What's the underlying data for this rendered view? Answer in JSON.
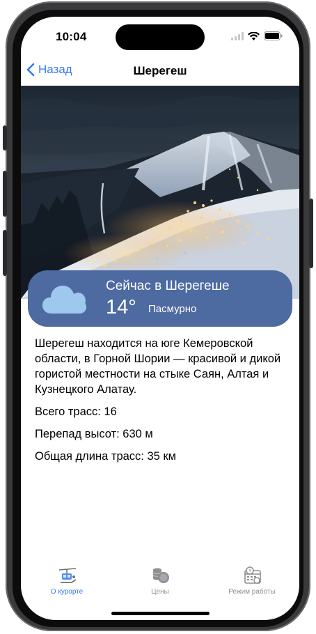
{
  "status_bar": {
    "time": "10:04"
  },
  "nav": {
    "back_label": "Назад",
    "title": "Шерегеш"
  },
  "weather": {
    "heading": "Сейчас в Шерегеше",
    "temperature": "14°",
    "condition": "Пасмурно",
    "icon": "cloud-icon"
  },
  "content": {
    "description": "Шерегеш находится на юге Кемеровской области, в Горной Шории — красивой и дикой гористой местности на стыке Саян, Алтая и Кузнецкого Алатау.",
    "stats": [
      "Всего трасс: 16",
      "Перепад высот: 630 м",
      "Общая длина трасс: 35 км"
    ]
  },
  "tabs": [
    {
      "label": "О курорте",
      "icon": "ski-lift-icon",
      "active": true
    },
    {
      "label": "Цены",
      "icon": "coins-icon",
      "active": false
    },
    {
      "label": "Режим работы",
      "icon": "calendar-clock-icon",
      "active": false
    }
  ],
  "colors": {
    "accent": "#3478f6",
    "weather_card": "#4d6aa1",
    "tab_inactive": "#8e8e93"
  }
}
